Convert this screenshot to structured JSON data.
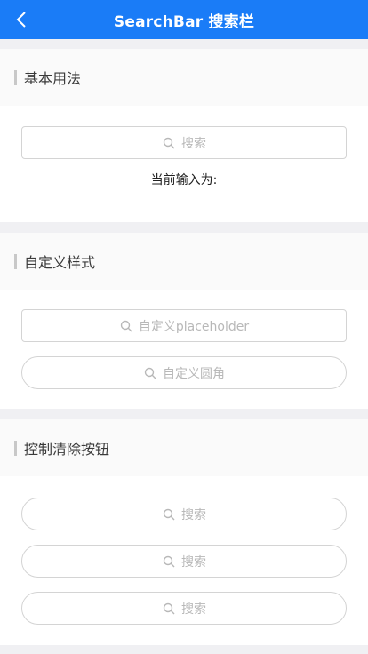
{
  "navbar": {
    "title": "SearchBar 搜索栏",
    "background_color": "#1a7cf7",
    "back_icon": "chevron-left-icon"
  },
  "sections": [
    {
      "title": "基本用法",
      "search": {
        "placeholder": "搜索"
      },
      "current_input_label": "当前输入为:"
    },
    {
      "title": "自定义样式",
      "search_custom_placeholder": {
        "placeholder": "自定义placeholder"
      },
      "search_round": {
        "placeholder": "自定义圆角"
      }
    },
    {
      "title": "控制清除按钮",
      "searches": [
        {
          "placeholder": "搜索"
        },
        {
          "placeholder": "搜索"
        },
        {
          "placeholder": "搜索"
        }
      ]
    }
  ]
}
